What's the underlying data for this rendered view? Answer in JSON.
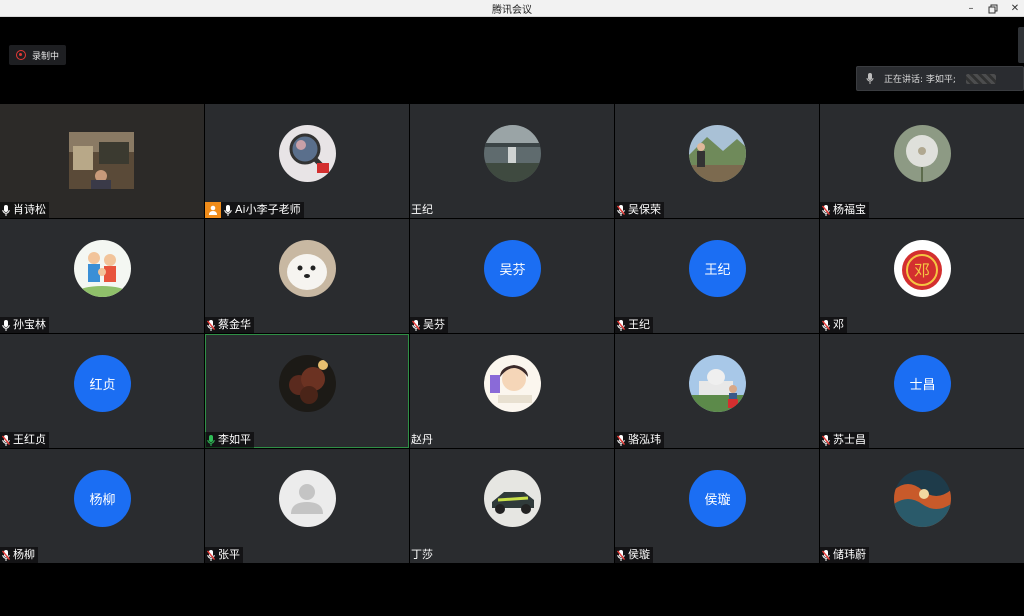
{
  "window": {
    "title": "腾讯会议"
  },
  "recording": {
    "label": "录制中"
  },
  "speaking": {
    "label": "正在讲话: 李如平;"
  },
  "participants": [
    {
      "name": "肖诗松",
      "mic": "on",
      "type": "video"
    },
    {
      "name": "Ai小李子老师",
      "mic": "on",
      "type": "photo",
      "img": "magnifier",
      "host": true
    },
    {
      "name": "王纪",
      "mic": "none",
      "type": "photo",
      "img": "bridge"
    },
    {
      "name": "吴保荣",
      "mic": "muted",
      "type": "photo",
      "img": "mountain-man"
    },
    {
      "name": "杨福宝",
      "mic": "muted",
      "type": "photo",
      "img": "dandelion"
    },
    {
      "name": "孙宝林",
      "mic": "on",
      "type": "photo",
      "img": "family-cartoon"
    },
    {
      "name": "蔡金华",
      "mic": "muted",
      "type": "photo",
      "img": "white-dog"
    },
    {
      "name": "吴芬",
      "mic": "muted",
      "type": "text",
      "initials": "吴芬"
    },
    {
      "name": "王纪",
      "mic": "muted",
      "type": "text",
      "initials": "王纪"
    },
    {
      "name": "邓",
      "mic": "muted",
      "type": "photo",
      "img": "red-seal"
    },
    {
      "name": "王红贞",
      "mic": "muted",
      "type": "text",
      "initials": "红贞"
    },
    {
      "name": "李如平",
      "mic": "speaking",
      "type": "photo",
      "img": "dark-plant",
      "active": true
    },
    {
      "name": "赵丹",
      "mic": "none",
      "type": "photo",
      "img": "cartoon-girl"
    },
    {
      "name": "骆泓玮",
      "mic": "muted",
      "type": "photo",
      "img": "capitol"
    },
    {
      "name": "苏士昌",
      "mic": "muted",
      "type": "text",
      "initials": "士昌"
    },
    {
      "name": "杨柳",
      "mic": "muted",
      "type": "text",
      "initials": "杨柳"
    },
    {
      "name": "张平",
      "mic": "muted",
      "type": "photo",
      "img": "default-user"
    },
    {
      "name": "丁莎",
      "mic": "none",
      "type": "photo",
      "img": "toy-car"
    },
    {
      "name": "侯璇",
      "mic": "muted",
      "type": "text",
      "initials": "侯璇"
    },
    {
      "name": "储玮蔚",
      "mic": "muted",
      "type": "photo",
      "img": "wave-art"
    }
  ],
  "colors": {
    "accent": "#1b6ef3",
    "speaking": "#2fbd57",
    "muted": "#e53935",
    "recording": "#e53935",
    "host": "#f08c1a"
  }
}
